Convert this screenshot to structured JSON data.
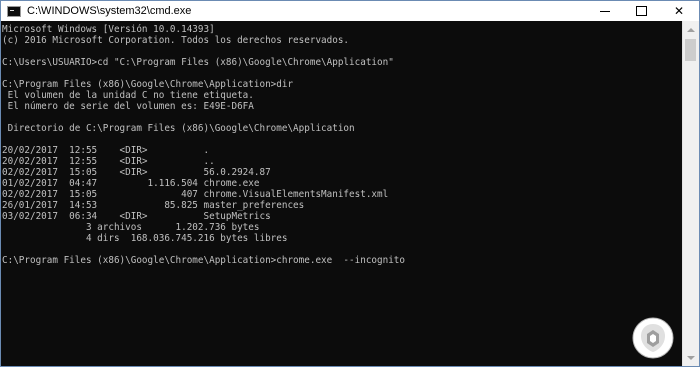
{
  "window": {
    "title": "C:\\WINDOWS\\system32\\cmd.exe",
    "controls": {
      "minimize": "minimize",
      "maximize": "maximize",
      "close": "✕"
    }
  },
  "terminal": {
    "lines": [
      "Microsoft Windows [Versión 10.0.14393]",
      "(c) 2016 Microsoft Corporation. Todos los derechos reservados.",
      "",
      "C:\\Users\\USUARIO>cd \"C:\\Program Files (x86)\\Google\\Chrome\\Application\"",
      "",
      "C:\\Program Files (x86)\\Google\\Chrome\\Application>dir",
      " El volumen de la unidad C no tiene etiqueta.",
      " El número de serie del volumen es: E49E-D6FA",
      "",
      " Directorio de C:\\Program Files (x86)\\Google\\Chrome\\Application",
      "",
      "20/02/2017  12:55    <DIR>          .",
      "20/02/2017  12:55    <DIR>          ..",
      "02/02/2017  15:05    <DIR>          56.0.2924.87",
      "01/02/2017  04:47         1.116.504 chrome.exe",
      "02/02/2017  15:05               407 chrome.VisualElementsManifest.xml",
      "26/01/2017  14:53            85.825 master_preferences",
      "03/02/2017  06:34    <DIR>          SetupMetrics",
      "               3 archivos      1.202.736 bytes",
      "               4 dirs  168.036.745.216 bytes libres",
      "",
      "C:\\Program Files (x86)\\Google\\Chrome\\Application>chrome.exe  --incognito"
    ]
  },
  "colors": {
    "console_background": "#0c0c0c",
    "console_text": "#c0c0c0",
    "titlebar": "#ffffff",
    "scrollbar_track": "#f0f0f0",
    "scrollbar_thumb": "#cdcdcd"
  },
  "icons": {
    "app": "cmd-console-icon",
    "scroll_up": "chevron-up-icon",
    "scroll_down": "chevron-down-icon",
    "watermark": "site-logo-icon"
  }
}
